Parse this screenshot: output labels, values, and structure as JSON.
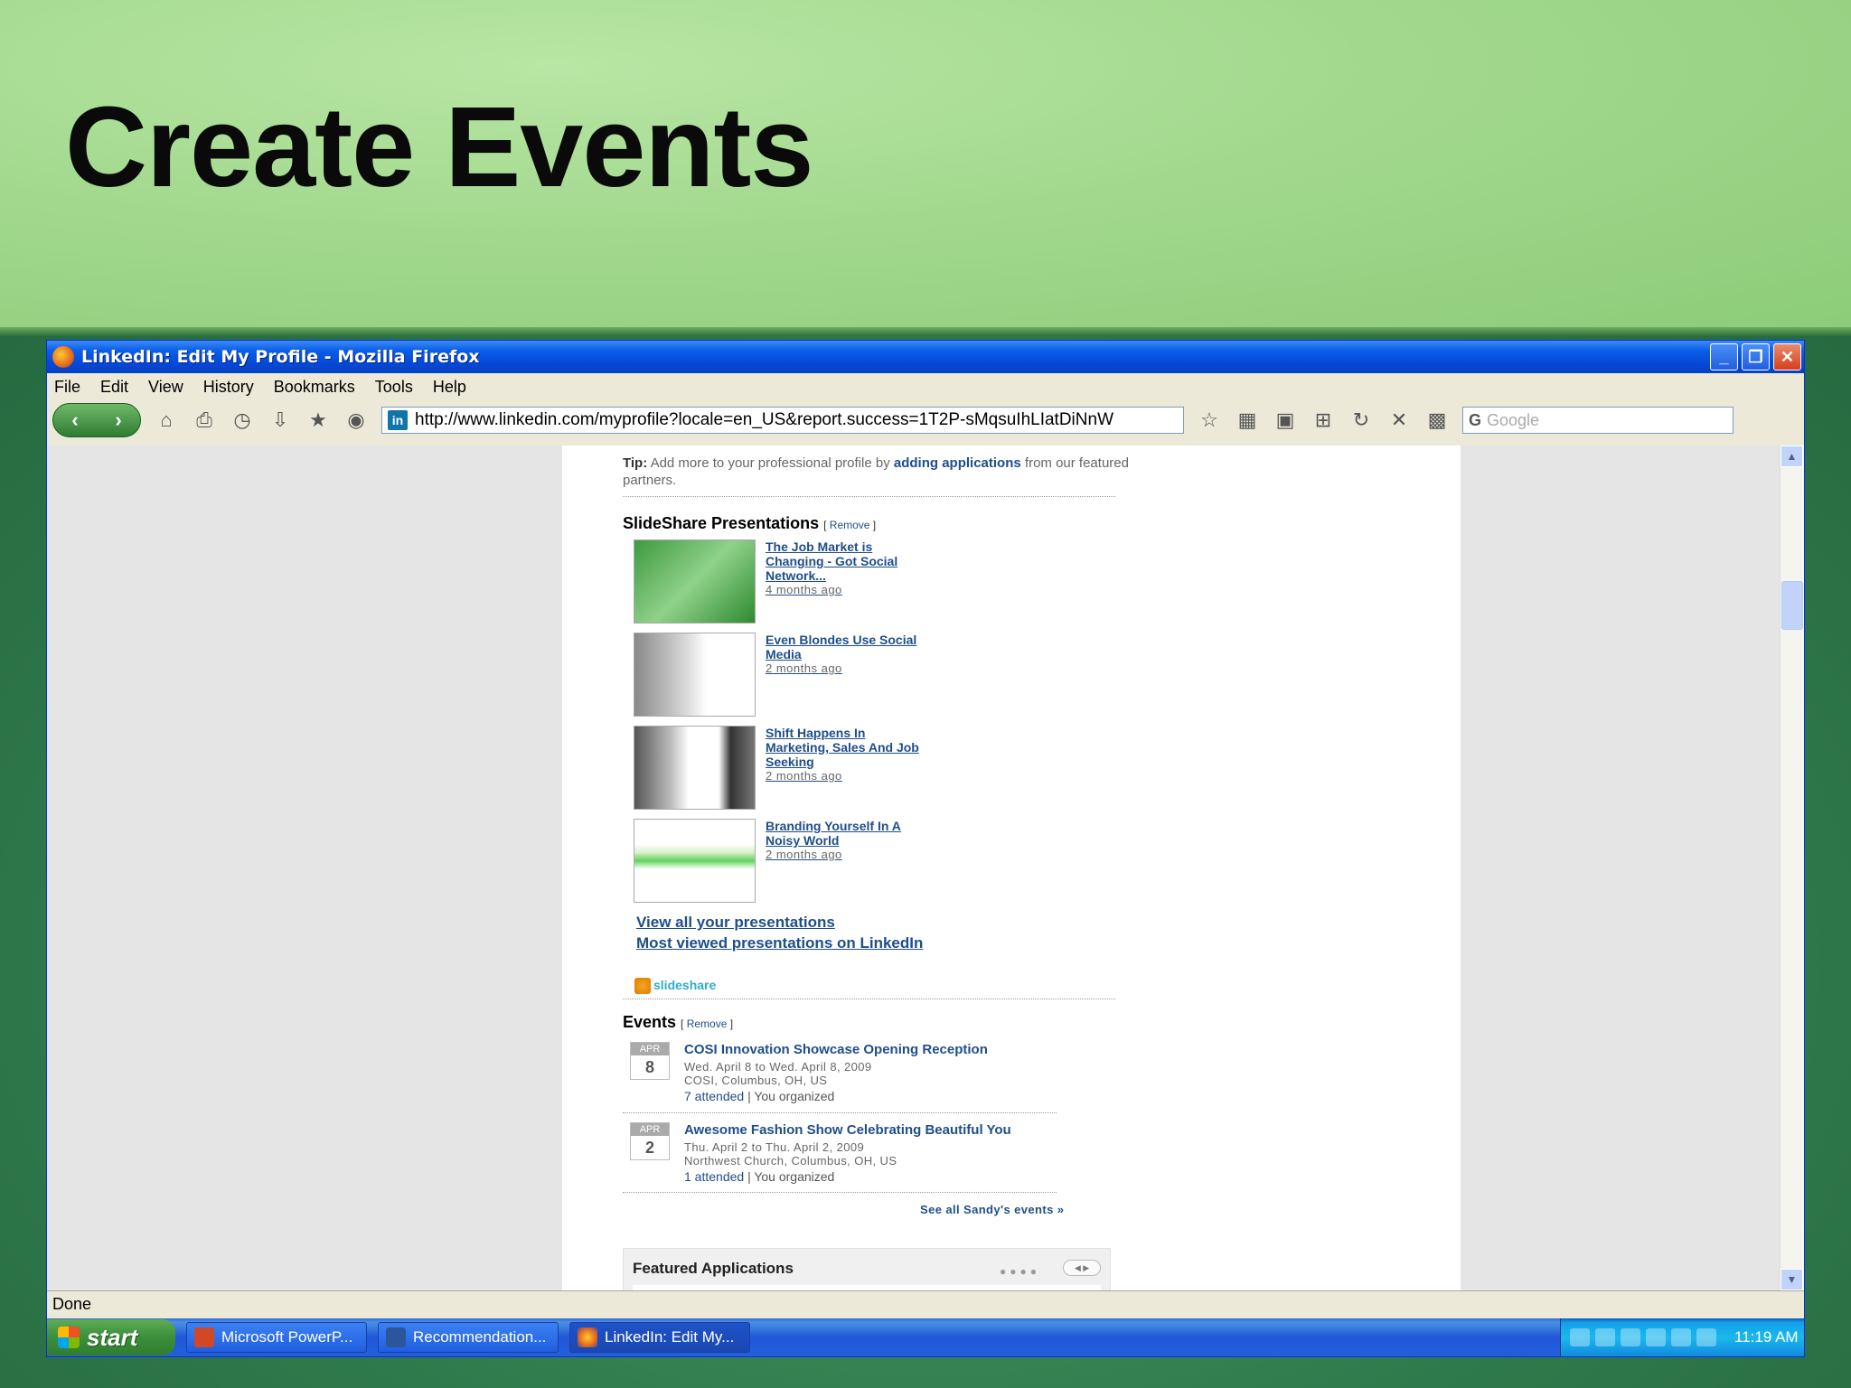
{
  "slide": {
    "title": "Create Events"
  },
  "window": {
    "title": "LinkedIn: Edit My Profile - Mozilla Firefox"
  },
  "menu": [
    "File",
    "Edit",
    "View",
    "History",
    "Bookmarks",
    "Tools",
    "Help"
  ],
  "toolbar": {
    "url": "http://www.linkedin.com/myprofile?locale=en_US&report.success=1T2P-sMqsuIhLIatDiNnW",
    "search_placeholder": "Google"
  },
  "page": {
    "tip_label": "Tip:",
    "tip_text1": "Add more to your professional profile by",
    "tip_link": "adding applications",
    "tip_text2": "from our featured partners.",
    "slideshare_heading": "SlideShare Presentations",
    "remove_label": "Remove",
    "presentations": [
      {
        "title": "The Job Market is Changing - Got Social Network...",
        "ago": "4 months ago"
      },
      {
        "title": "Even Blondes Use Social Media",
        "ago": "2 months ago"
      },
      {
        "title": "Shift Happens In Marketing, Sales And Job Seeking",
        "ago": "2 months ago"
      },
      {
        "title": "Branding Yourself In A Noisy World",
        "ago": "2 months ago"
      }
    ],
    "view_all": "View all your presentations",
    "most_viewed": "Most viewed presentations on LinkedIn",
    "slideshare_logo": "slideshare",
    "events_heading": "Events",
    "events": [
      {
        "month": "APR",
        "day": "8",
        "name": "COSI Innovation Showcase Opening Reception",
        "dates": "Wed. April 8 to Wed. April 8, 2009",
        "location": "COSI, Columbus, OH, US",
        "attended": "7 attended",
        "organized": "| You organized"
      },
      {
        "month": "APR",
        "day": "2",
        "name": "Awesome Fashion Show Celebrating Beautiful You",
        "dates": "Thu. April 2 to Thu. April 2, 2009",
        "location": "Northwest Church, Columbus, OH, US",
        "attended": "1 attended",
        "organized": "| You organized"
      }
    ],
    "see_all": "See all Sandy's events »",
    "featured_heading": "Featured Applications"
  },
  "status": "Done",
  "taskbar": {
    "start": "start",
    "tasks": [
      "Microsoft PowerP...",
      "Recommendation...",
      "LinkedIn: Edit My..."
    ],
    "clock": "11:19 AM"
  }
}
